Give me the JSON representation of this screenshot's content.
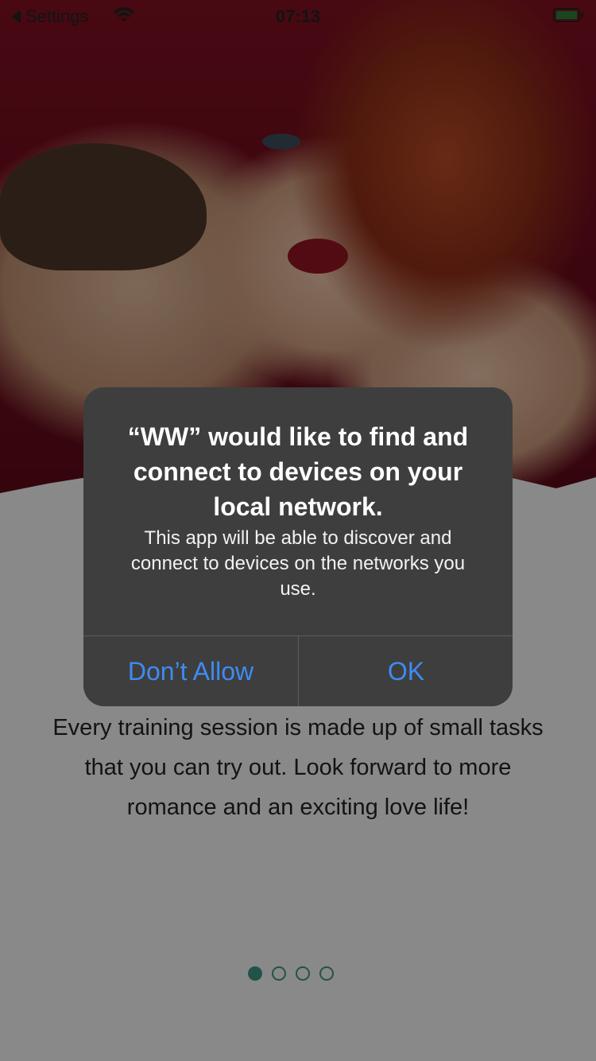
{
  "status_bar": {
    "back_label": "Settings",
    "time": "07:13"
  },
  "onboarding": {
    "description": "Every training session is made up of small tasks that you can try out. Look forward to more romance and an exciting love life!",
    "pager": {
      "total": 4,
      "active_index": 0
    }
  },
  "alert": {
    "title": "“WW” would like to find and connect to devices on your local network.",
    "message": "This app will be able to discover and connect to devices on the networks you use.",
    "deny_label": "Don’t Allow",
    "ok_label": "OK"
  },
  "colors": {
    "accent_teal": "#3a8f7f",
    "alert_button_blue": "#3d8cf2",
    "alert_bg": "#3e3e3e"
  }
}
